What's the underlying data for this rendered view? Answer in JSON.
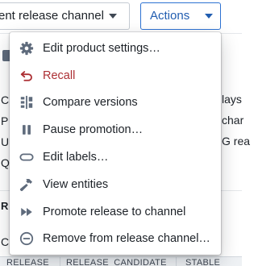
{
  "toolbar": {
    "channel_select_value": "ent release channel",
    "actions_label": "Actions"
  },
  "background": {
    "left_fragments": [
      "C",
      "P",
      "U",
      "Q"
    ],
    "right_fragments": [
      "lays",
      "char",
      "G rea"
    ],
    "section_fragment": "R",
    "row_fragment": "C",
    "table_columns": [
      "RELEASE",
      "RELEASE_CANDIDATE",
      "STABLE"
    ]
  },
  "menu": {
    "items": [
      {
        "label": "Edit product settings…",
        "icon": "gear-icon"
      },
      {
        "label": "Recall",
        "icon": "undo-icon",
        "style": "danger",
        "color": "#ac2f33"
      },
      {
        "label": "Compare versions",
        "icon": "compare-icon"
      },
      {
        "label": "Pause promotion…",
        "icon": "pause-icon"
      },
      {
        "label": "Edit labels…",
        "icon": "tag-outline-icon"
      },
      {
        "label": "View entities",
        "icon": "hammer-icon"
      },
      {
        "label": "Promote release to channel",
        "icon": "fast-forward-icon"
      },
      {
        "label": "Remove from release channel…",
        "icon": "remove-circle-icon"
      }
    ]
  },
  "colors": {
    "accent": "#215db0",
    "icon": "#5f6b7c",
    "danger": "#ac2f33",
    "text": "#1c2127"
  }
}
